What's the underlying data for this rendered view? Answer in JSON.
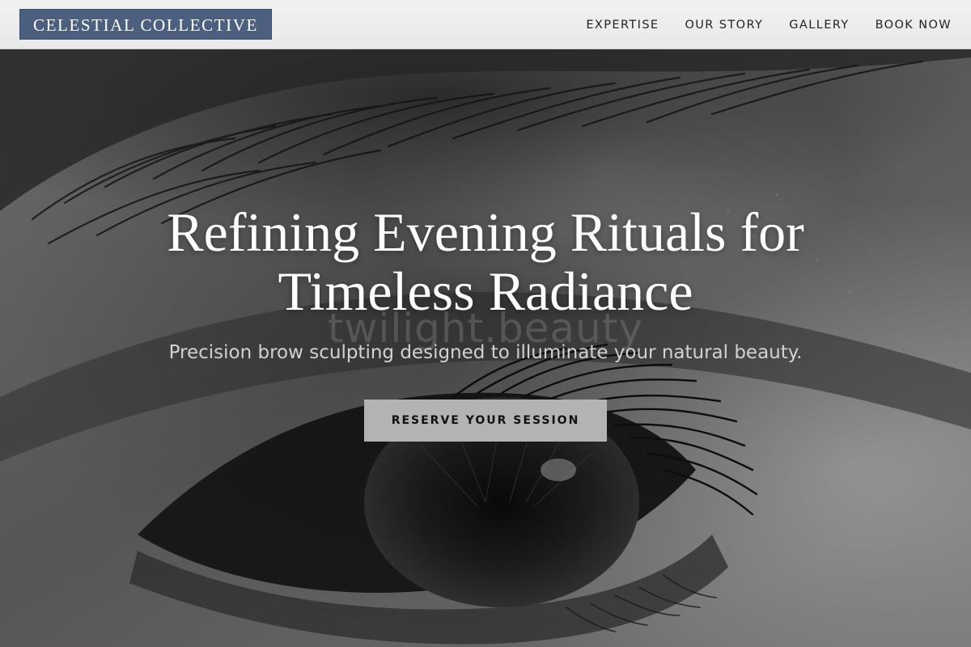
{
  "header": {
    "logo_text": "CELESTIAL COLLECTIVE",
    "nav": [
      {
        "label": "EXPERTISE"
      },
      {
        "label": "OUR STORY"
      },
      {
        "label": "GALLERY"
      },
      {
        "label": "BOOK NOW"
      }
    ]
  },
  "hero": {
    "background": "black-and-white close-up photo of an eye and brow",
    "watermark": "twilight.beauty",
    "title": "Refining Evening Rituals for Timeless Radiance",
    "subtitle": "Precision brow sculpting designed to illuminate your natural beauty.",
    "cta_label": "RESERVE YOUR SESSION"
  },
  "colors": {
    "header_bg": "#efefef",
    "logo_bg": "#4c5f7f",
    "logo_text": "#ffffff",
    "nav_text": "#222222",
    "title_text": "#ffffff",
    "subtitle_text": "#d2d2d2",
    "cta_bg": "#b3b3b3",
    "cta_text": "#111111"
  }
}
